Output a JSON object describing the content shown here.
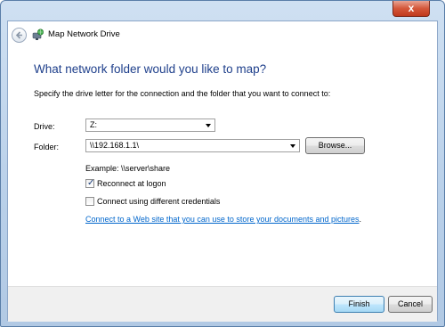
{
  "window": {
    "title": "Map Network Drive",
    "close_label": "x"
  },
  "wizard": {
    "heading": "What network folder would you like to map?",
    "instruction": "Specify the drive letter for the connection and the folder that you want to connect to:"
  },
  "form": {
    "drive_label": "Drive:",
    "drive_value": "Z:",
    "folder_label": "Folder:",
    "folder_value": "\\\\192.168.1.1\\",
    "browse_label": "Browse...",
    "example_text": "Example: \\\\server\\share",
    "reconnect_label": "Reconnect at logon",
    "reconnect_checked": true,
    "credentials_label": "Connect using different credentials",
    "credentials_checked": false,
    "link_text": "Connect to a Web site that you can use to store your documents and pictures",
    "link_trailing": "."
  },
  "footer": {
    "finish_label": "Finish",
    "cancel_label": "Cancel"
  },
  "icons": {
    "back": "back-arrow-icon",
    "app": "network-drive-icon",
    "close": "close-icon",
    "dropdown": "chevron-down-icon",
    "checkmark": "checkmark-icon"
  }
}
